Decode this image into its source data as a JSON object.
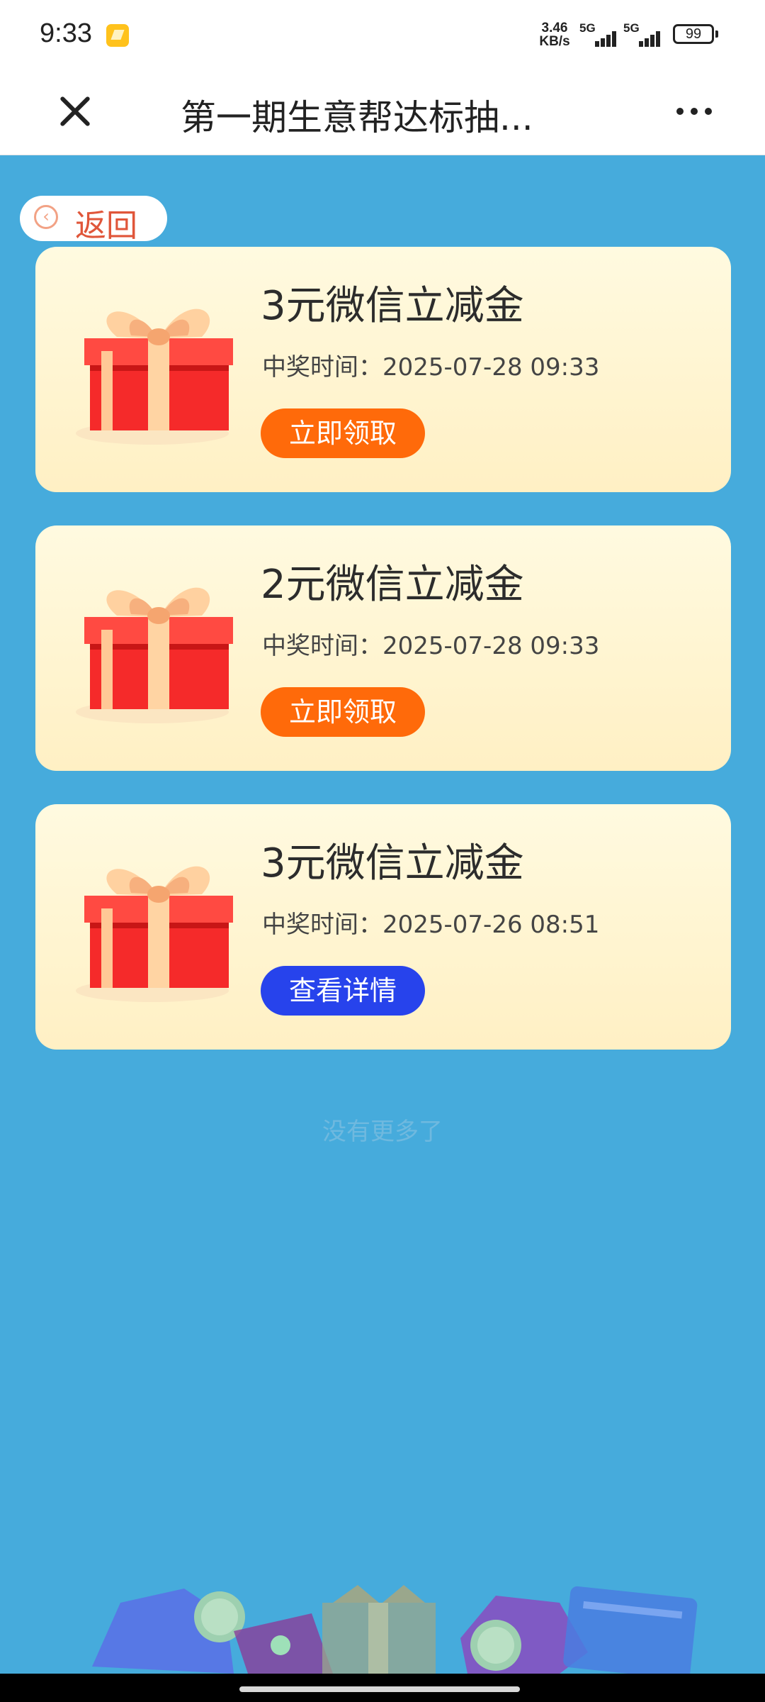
{
  "status_bar": {
    "time": "9:33",
    "net_speed_value": "3.46",
    "net_speed_unit": "KB/s",
    "signal_1": "5G",
    "signal_2": "5G",
    "battery": "99"
  },
  "title_bar": {
    "title": "第一期生意帮达标抽...",
    "close_icon": "close-icon",
    "more_icon": "more-icon"
  },
  "back": {
    "label": "返回"
  },
  "prizes": [
    {
      "name": "3元微信立减金",
      "time": "中奖时间：2025-07-28 09:33",
      "button": "立即领取",
      "button_color": "#ff6a0a"
    },
    {
      "name": "2元微信立减金",
      "time": "中奖时间：2025-07-28 09:33",
      "button": "立即领取",
      "button_color": "#ff6a0a"
    },
    {
      "name": "3元微信立减金",
      "time": "中奖时间：2025-07-26 08:51",
      "button": "查看详情",
      "button_color": "#2743ec"
    }
  ],
  "footer": {
    "no_more": "没有更多了"
  },
  "colors": {
    "background": "#46abdc",
    "card": "#fff5d4"
  }
}
